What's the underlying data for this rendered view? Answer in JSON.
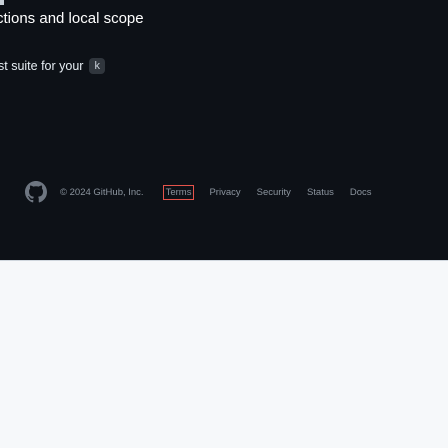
{
  "heading_fragment": "ctions and local scope",
  "subline": {
    "text": "st suite for your",
    "kbd": "k"
  },
  "footer": {
    "copyright": "© 2024 GitHub, Inc.",
    "links": [
      "Terms",
      "Privacy",
      "Security",
      "Status",
      "Docs"
    ]
  },
  "colors": {
    "dark_bg": "#0d1117",
    "light_bg": "#f6f8fa",
    "focus_outline": "#e5534b"
  }
}
